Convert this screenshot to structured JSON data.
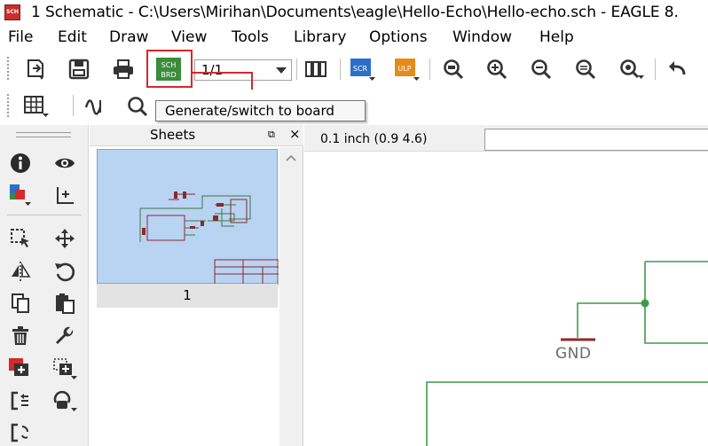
{
  "window": {
    "title": "1 Schematic - C:\\Users\\Mirihan\\Documents\\eagle\\Hello-Echo\\Hello-echo.sch - EAGLE 8.",
    "app_icon_text": "SCH"
  },
  "menu": [
    "File",
    "Edit",
    "Draw",
    "View",
    "Tools",
    "Library",
    "Options",
    "Window",
    "Help"
  ],
  "toolbar": {
    "sheet_select_value": "1/1",
    "scr_label": "SCR",
    "ulp_label": "ULP",
    "board_icon_top": "SCH",
    "board_icon_bottom": "BRD",
    "tooltip": "Generate/switch to board",
    "highlight_color": "#d42a2a"
  },
  "sheets_panel": {
    "title": "Sheets",
    "close_label": "×",
    "dock_label": "⧉",
    "sheets": [
      {
        "label": "1"
      }
    ]
  },
  "canvas": {
    "coordinate_readout": "0.1 inch (0.9 4.6)",
    "command_value": "",
    "gnd_label": "GND",
    "wire_color": "#3d9a4a",
    "gnd_color": "#8b2a2a"
  },
  "icons": [
    "new-icon",
    "save-icon",
    "print-icon",
    "board-switch-icon",
    "sheets-icon",
    "scr-icon",
    "ulp-icon",
    "zoom-fit-icon",
    "zoom-in-icon",
    "zoom-out-icon",
    "zoom-redraw-icon",
    "zoom-select-icon",
    "undo-icon",
    "grid-icon",
    "layer-icon",
    "mark-icon",
    "info-icon",
    "show-icon",
    "display-icon",
    "origin-icon",
    "group-icon",
    "move-icon",
    "mirror-icon",
    "rotate-icon",
    "copy-icon",
    "paste-icon",
    "delete-icon",
    "wrench-icon",
    "add-icon",
    "replace-icon",
    "pinswap-icon",
    "gateswap-icon",
    "optimize-icon"
  ]
}
